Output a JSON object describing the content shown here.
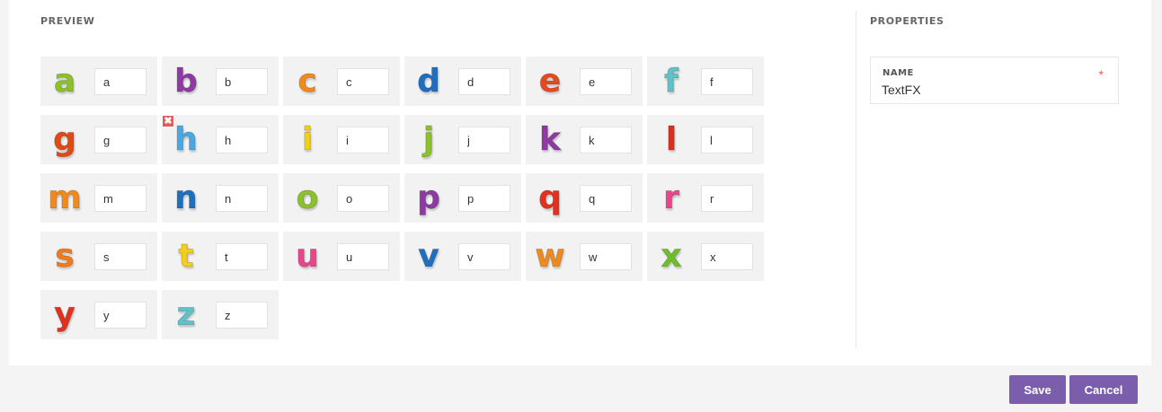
{
  "preview": {
    "title": "PREVIEW",
    "letters": [
      {
        "char": "a",
        "value": "a",
        "color": "#8bc12a"
      },
      {
        "char": "b",
        "value": "b",
        "color": "#8e3aa2"
      },
      {
        "char": "c",
        "value": "c",
        "color": "#f08a1c"
      },
      {
        "char": "d",
        "value": "d",
        "color": "#1f6fc0"
      },
      {
        "char": "e",
        "value": "e",
        "color": "#e54a1e"
      },
      {
        "char": "f",
        "value": "f",
        "color": "#5fc2c9"
      },
      {
        "char": "g",
        "value": "g",
        "color": "#e04a16"
      },
      {
        "char": "h",
        "value": "h",
        "color": "#4aa8e0"
      },
      {
        "char": "i",
        "value": "i",
        "color": "#f4cf1a"
      },
      {
        "char": "j",
        "value": "j",
        "color": "#8bc12a"
      },
      {
        "char": "k",
        "value": "k",
        "color": "#8e3aa2"
      },
      {
        "char": "l",
        "value": "l",
        "color": "#d8321e"
      },
      {
        "char": "m",
        "value": "m",
        "color": "#f08a1c"
      },
      {
        "char": "n",
        "value": "n",
        "color": "#1f6fc0"
      },
      {
        "char": "o",
        "value": "o",
        "color": "#8bc12a"
      },
      {
        "char": "p",
        "value": "p",
        "color": "#8e3aa2"
      },
      {
        "char": "q",
        "value": "q",
        "color": "#e0321e"
      },
      {
        "char": "r",
        "value": "r",
        "color": "#e8468a"
      },
      {
        "char": "s",
        "value": "s",
        "color": "#f07a1c"
      },
      {
        "char": "t",
        "value": "t",
        "color": "#f4cf1a"
      },
      {
        "char": "u",
        "value": "u",
        "color": "#e8468a"
      },
      {
        "char": "v",
        "value": "v",
        "color": "#1f6fc0"
      },
      {
        "char": "w",
        "value": "w",
        "color": "#f08a1c"
      },
      {
        "char": "x",
        "value": "x",
        "color": "#6cbf2a"
      },
      {
        "char": "y",
        "value": "y",
        "color": "#e0321e"
      },
      {
        "char": "z",
        "value": "z",
        "color": "#5fc2c9"
      }
    ]
  },
  "properties": {
    "title": "PROPERTIES",
    "name_label": "NAME",
    "required_mark": "*",
    "name_value": "TextFX"
  },
  "footer": {
    "save_label": "Save",
    "cancel_label": "Cancel"
  },
  "icons": {
    "remove": "close-icon"
  }
}
